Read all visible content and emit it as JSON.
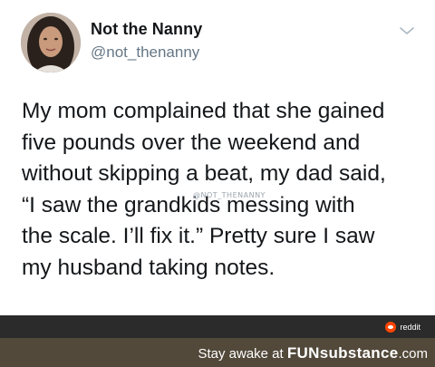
{
  "tweet": {
    "author": {
      "display_name": "Not the Nanny",
      "handle": "@not_thenanny"
    },
    "menu_icon": "chevron-down-icon",
    "lines": [
      "My mom complained that she gained",
      "five pounds over the weekend and",
      "without skipping a beat, my dad said,",
      "“I saw the grandkids messing with",
      "the scale. I’ll fix it.” Pretty sure I saw",
      "my husband taking notes."
    ],
    "watermark": "@NOT_THENANNY"
  },
  "reddit_badge": {
    "label": "reddit",
    "icon": "reddit-logo-icon",
    "color": "#ff4500"
  },
  "footer": {
    "prefix": "Stay awake at",
    "brand": "FUNsubstance",
    "domain": ".com",
    "background": "#52493a"
  }
}
